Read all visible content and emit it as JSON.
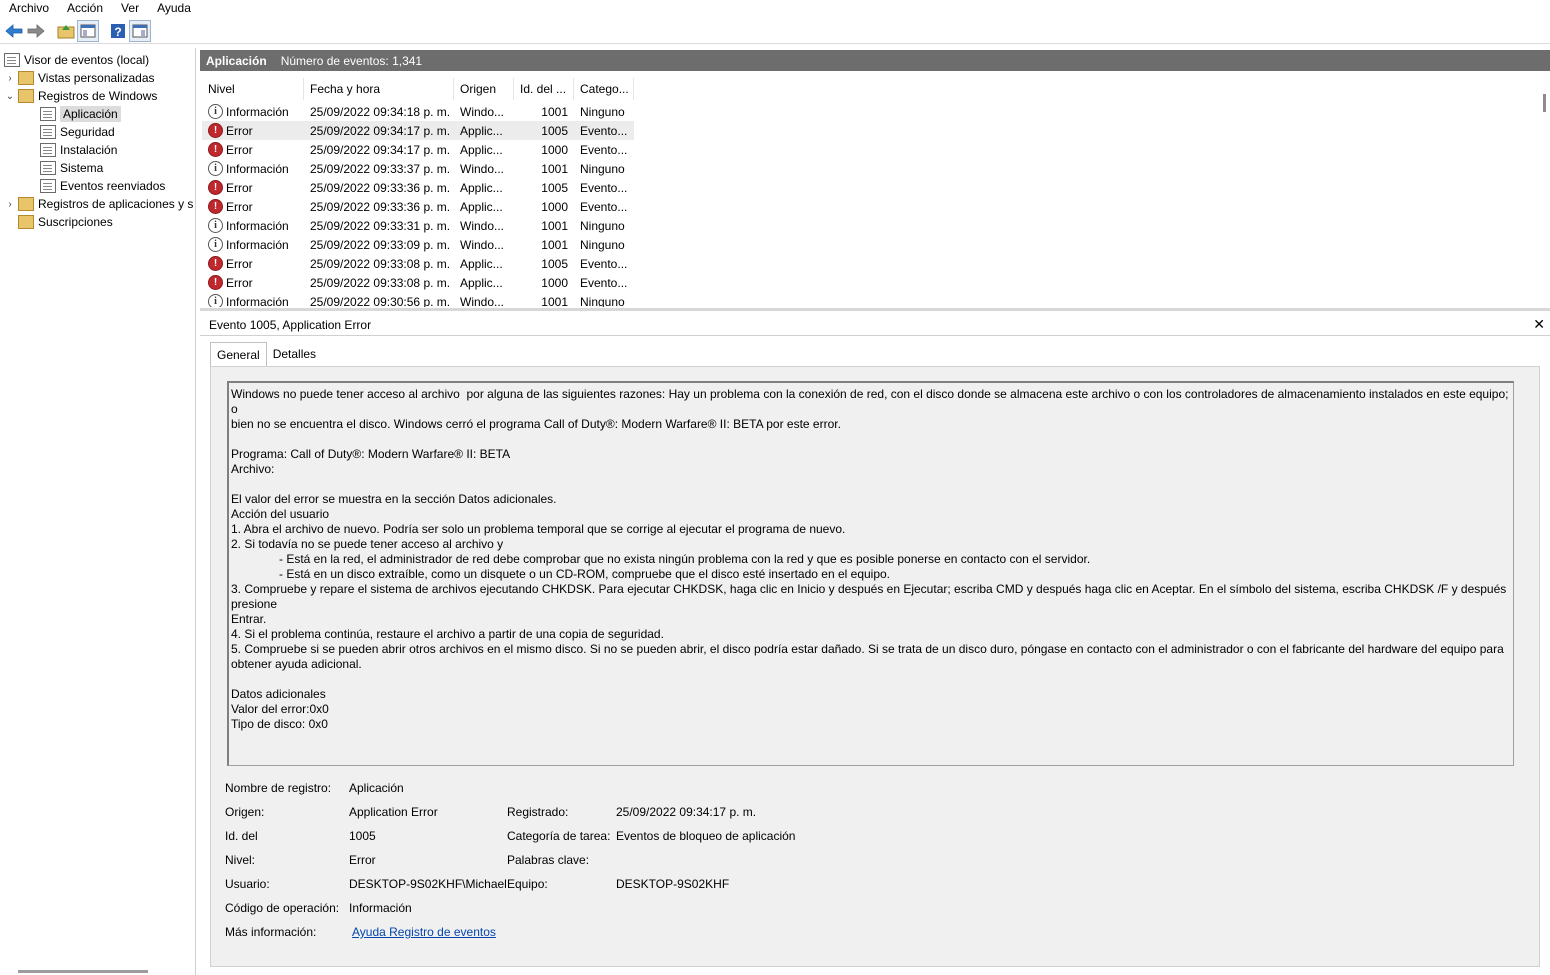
{
  "menu": [
    "Archivo",
    "Acción",
    "Ver",
    "Ayuda"
  ],
  "toolbar": {
    "buttons": [
      "back-arrow-icon",
      "forward-arrow-icon",
      "folder-up-icon",
      "show-hide-tree-icon",
      "help-icon",
      "action-pane-icon"
    ]
  },
  "nav": {
    "root": "Visor de eventos (local)",
    "custom_views": "Vistas personalizadas",
    "windows_logs": "Registros de Windows",
    "app": "Aplicación",
    "security": "Seguridad",
    "setup": "Instalación",
    "system": "Sistema",
    "forwarded": "Eventos reenviados",
    "app_service_logs": "Registros de aplicaciones y s",
    "subscriptions": "Suscripciones"
  },
  "header": {
    "log_name": "Aplicación",
    "event_count": "Número de eventos: 1,341"
  },
  "columns": [
    "Nivel",
    "Fecha y hora",
    "Origen",
    "Id. del ...",
    "Catego..."
  ],
  "events": [
    {
      "level": "Información",
      "type": "info",
      "date": "25/09/2022 09:34:18 p. m.",
      "source": "Windo...",
      "id": "1001",
      "category": "Ninguno"
    },
    {
      "level": "Error",
      "type": "error",
      "date": "25/09/2022 09:34:17 p. m.",
      "source": "Applic...",
      "id": "1005",
      "category": "Evento..."
    },
    {
      "level": "Error",
      "type": "error",
      "date": "25/09/2022 09:34:17 p. m.",
      "source": "Applic...",
      "id": "1000",
      "category": "Evento..."
    },
    {
      "level": "Información",
      "type": "info",
      "date": "25/09/2022 09:33:37 p. m.",
      "source": "Windo...",
      "id": "1001",
      "category": "Ninguno"
    },
    {
      "level": "Error",
      "type": "error",
      "date": "25/09/2022 09:33:36 p. m.",
      "source": "Applic...",
      "id": "1005",
      "category": "Evento..."
    },
    {
      "level": "Error",
      "type": "error",
      "date": "25/09/2022 09:33:36 p. m.",
      "source": "Applic...",
      "id": "1000",
      "category": "Evento..."
    },
    {
      "level": "Información",
      "type": "info",
      "date": "25/09/2022 09:33:31 p. m.",
      "source": "Windo...",
      "id": "1001",
      "category": "Ninguno"
    },
    {
      "level": "Información",
      "type": "info",
      "date": "25/09/2022 09:33:09 p. m.",
      "source": "Windo...",
      "id": "1001",
      "category": "Ninguno"
    },
    {
      "level": "Error",
      "type": "error",
      "date": "25/09/2022 09:33:08 p. m.",
      "source": "Applic...",
      "id": "1005",
      "category": "Evento..."
    },
    {
      "level": "Error",
      "type": "error",
      "date": "25/09/2022 09:33:08 p. m.",
      "source": "Applic...",
      "id": "1000",
      "category": "Evento..."
    },
    {
      "level": "Información",
      "type": "info",
      "date": "25/09/2022 09:30:56 p. m.",
      "source": "Windo...",
      "id": "1001",
      "category": "Ninguno"
    }
  ],
  "selected_row": 1,
  "detail": {
    "title": "Evento 1005, Application Error",
    "close": "✕",
    "tabs": [
      "General",
      "Detalles"
    ],
    "description_lines": [
      "Windows no puede tener acceso al archivo  por alguna de las siguientes razones: Hay un problema con la conexión de red, con el disco donde se almacena este archivo o con los controladores de almacenamiento instalados en este equipo; o",
      "bien no se encuentra el disco. Windows cerró el programa Call of Duty®: Modern Warfare® II: BETA por este error.",
      "",
      "Programa: Call of Duty®: Modern Warfare® II: BETA",
      "Archivo:",
      "",
      "El valor del error se muestra en la sección Datos adicionales.",
      "Acción del usuario",
      "1. Abra el archivo de nuevo. Podría ser solo un problema temporal que se corrige al ejecutar el programa de nuevo.",
      "2. Si todavía no se puede tener acceso al archivo y",
      "- Está en la red, el administrador de red debe comprobar que no exista ningún problema con la red y que es posible ponerse en contacto con el servidor.",
      "- Está en un disco extraíble, como un disquete o un CD-ROM, compruebe que el disco esté insertado en el equipo.",
      "3. Compruebe y repare el sistema de archivos ejecutando CHKDSK. Para ejecutar CHKDSK, haga clic en Inicio y después en Ejecutar; escriba CMD y después haga clic en Aceptar. En el símbolo del sistema, escriba CHKDSK /F y después presione",
      "Entrar.",
      "4. Si el problema continúa, restaure el archivo a partir de una copia de seguridad.",
      "5. Compruebe si se pueden abrir otros archivos en el mismo disco. Si no se pueden abrir, el disco podría estar dañado. Si se trata de un disco duro, póngase en contacto con el administrador o con el fabricante del hardware del equipo para",
      "obtener ayuda adicional.",
      "",
      "Datos adicionales",
      "Valor del error:0x0",
      "Tipo de disco: 0x0"
    ],
    "props": {
      "log_name_label": "Nombre de registro:",
      "log_name": "Aplicación",
      "source_label": "Origen:",
      "source": "Application Error",
      "logged_label": "Registrado:",
      "logged": "25/09/2022 09:34:17 p. m.",
      "event_id_label": "Id. del",
      "event_id": "1005",
      "task_label": "Categoría de tarea:",
      "task": "Eventos de bloqueo de aplicación",
      "level_label": "Nivel:",
      "level": "Error",
      "keywords_label": "Palabras clave:",
      "keywords": "",
      "user_label": "Usuario:",
      "user": "DESKTOP-9S02KHF\\Michael",
      "computer_label": "Equipo:",
      "computer": "DESKTOP-9S02KHF",
      "opcode_label": "Código de operación:",
      "opcode": "Información",
      "more_info_label": "Más información:",
      "more_info_link": "Ayuda Registro de eventos"
    }
  }
}
